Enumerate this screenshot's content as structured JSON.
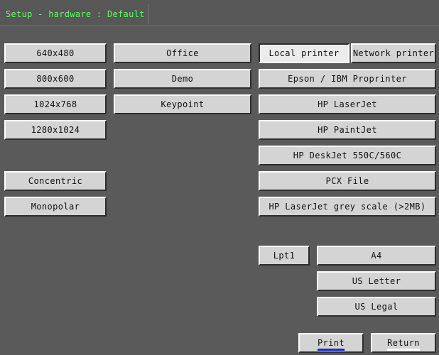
{
  "window": {
    "title": "Setup - hardware : Default"
  },
  "resolutions": [
    "640x480",
    "800x600",
    "1024x768",
    "1280x1024"
  ],
  "profiles": [
    "Office",
    "Demo",
    "Keypoint"
  ],
  "mode": {
    "concentric": "Concentric",
    "monopolar": "Monopolar"
  },
  "printer_source": {
    "local": "Local printer",
    "network": "Network printer"
  },
  "printers": [
    "Epson / IBM Proprinter",
    "HP LaserJet",
    "HP PaintJet",
    "HP DeskJet 550C/560C",
    "PCX File",
    "HP LaserJet grey scale (>2MB)"
  ],
  "port": "Lpt1",
  "paper_sizes": [
    "A4",
    "US Letter",
    "US Legal"
  ],
  "actions": {
    "print": "Print",
    "return": "Return"
  },
  "colors": {
    "title_text": "#5dff5d",
    "background": "#5a5a5a",
    "button": "#d4d4d4",
    "print_underline": "#1530c9"
  }
}
